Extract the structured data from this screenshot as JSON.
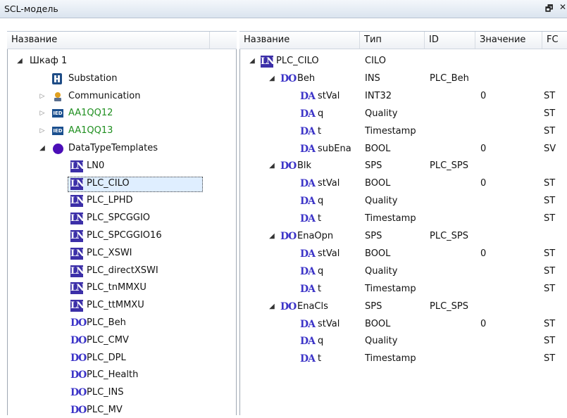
{
  "window": {
    "title": "SCL-модель",
    "float_glyph": "🗗",
    "close_glyph": "✕"
  },
  "left": {
    "header": "Название",
    "root": "Шкаф 1",
    "substation": "Substation",
    "communication": "Communication",
    "ied1": "AA1QQ12",
    "ied2": "AA1QQ13",
    "templates": "DataTypeTemplates",
    "items": [
      {
        "badge": "LN",
        "label": "LN0"
      },
      {
        "badge": "LN",
        "label": "PLC_CILO"
      },
      {
        "badge": "LN",
        "label": "PLC_LPHD"
      },
      {
        "badge": "LN",
        "label": "PLC_SPCGGIO"
      },
      {
        "badge": "LN",
        "label": "PLC_SPCGGIO16"
      },
      {
        "badge": "LN",
        "label": "PLC_XSWI"
      },
      {
        "badge": "LN",
        "label": "PLC_directXSWI"
      },
      {
        "badge": "LN",
        "label": "PLC_tnMMXU"
      },
      {
        "badge": "LN",
        "label": "PLC_ttMMXU"
      },
      {
        "badge": "DO",
        "label": "PLC_Beh"
      },
      {
        "badge": "DO",
        "label": "PLC_CMV"
      },
      {
        "badge": "DO",
        "label": "PLC_DPL"
      },
      {
        "badge": "DO",
        "label": "PLC_Health"
      },
      {
        "badge": "DO",
        "label": "PLC_INS"
      },
      {
        "badge": "DO",
        "label": "PLC_MV"
      }
    ],
    "ied_badge": "IED"
  },
  "right": {
    "columns": {
      "name": "Название",
      "type": "Тип",
      "id": "ID",
      "value": "Значение",
      "fc": "FC"
    },
    "root": {
      "badge": "LN",
      "name": "PLC_CILO",
      "type": "CILO"
    },
    "dos": [
      {
        "badge": "DO",
        "name": "Beh",
        "type": "INS",
        "id": "PLC_Beh",
        "das": [
          {
            "badge": "DA",
            "name": "stVal",
            "type": "INT32",
            "value": "0",
            "fc": "ST"
          },
          {
            "badge": "DA",
            "name": "q",
            "type": "Quality",
            "value": "",
            "fc": "ST"
          },
          {
            "badge": "DA",
            "name": "t",
            "type": "Timestamp",
            "value": "",
            "fc": "ST"
          },
          {
            "badge": "DA",
            "name": "subEna",
            "type": "BOOL",
            "value": "0",
            "fc": "SV"
          }
        ]
      },
      {
        "badge": "DO",
        "name": "Blk",
        "type": "SPS",
        "id": "PLC_SPS",
        "das": [
          {
            "badge": "DA",
            "name": "stVal",
            "type": "BOOL",
            "value": "0",
            "fc": "ST"
          },
          {
            "badge": "DA",
            "name": "q",
            "type": "Quality",
            "value": "",
            "fc": "ST"
          },
          {
            "badge": "DA",
            "name": "t",
            "type": "Timestamp",
            "value": "",
            "fc": "ST"
          }
        ]
      },
      {
        "badge": "DO",
        "name": "EnaOpn",
        "type": "SPS",
        "id": "PLC_SPS",
        "das": [
          {
            "badge": "DA",
            "name": "stVal",
            "type": "BOOL",
            "value": "0",
            "fc": "ST"
          },
          {
            "badge": "DA",
            "name": "q",
            "type": "Quality",
            "value": "",
            "fc": "ST"
          },
          {
            "badge": "DA",
            "name": "t",
            "type": "Timestamp",
            "value": "",
            "fc": "ST"
          }
        ]
      },
      {
        "badge": "DO",
        "name": "EnaCls",
        "type": "SPS",
        "id": "PLC_SPS",
        "das": [
          {
            "badge": "DA",
            "name": "stVal",
            "type": "BOOL",
            "value": "0",
            "fc": "ST"
          },
          {
            "badge": "DA",
            "name": "q",
            "type": "Quality",
            "value": "",
            "fc": "ST"
          },
          {
            "badge": "DA",
            "name": "t",
            "type": "Timestamp",
            "value": "",
            "fc": "ST"
          }
        ]
      }
    ]
  },
  "colors": {
    "ln_badge": "#3c2fa8",
    "do_da_badge_text": "#3d35c8",
    "ied_text": "#1f8f1f",
    "templates_dot": "#4b0eb7"
  }
}
